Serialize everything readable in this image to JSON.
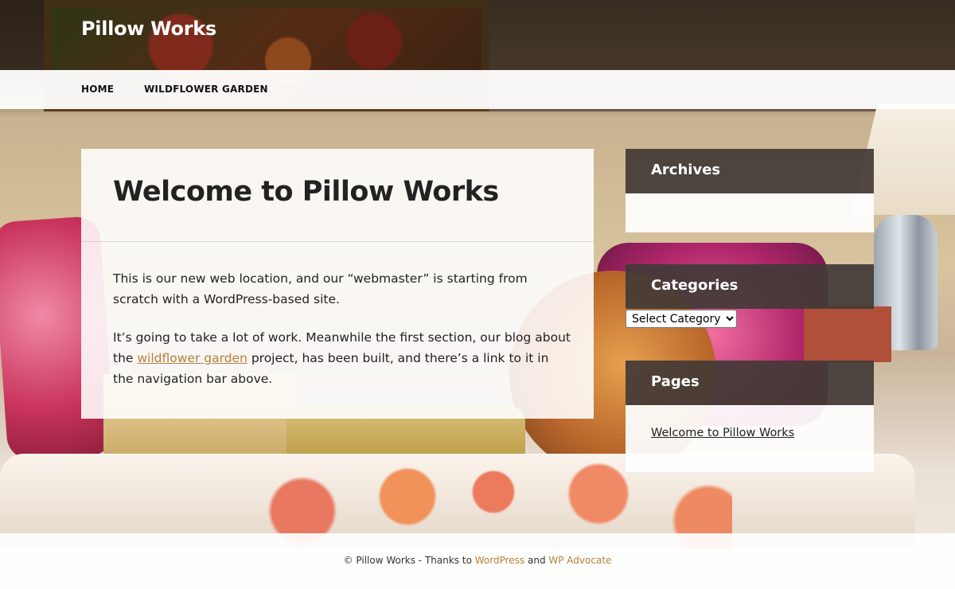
{
  "site": {
    "title": "Pillow Works"
  },
  "nav": {
    "items": [
      {
        "label": "HOME"
      },
      {
        "label": "WILDFLOWER GARDEN"
      }
    ]
  },
  "post": {
    "title": "Welcome to Pillow Works",
    "p1": "This is our new web location, and our “webmaster” is starting from scratch with a WordPress-based site.",
    "p2_before": "It’s going to take a lot of work. Meanwhile the first section, our blog about the ",
    "p2_link": "wildflower garden",
    "p2_after": " project, has been built, and there’s a link to it in the navigation bar above."
  },
  "sidebar": {
    "archives_title": "Archives",
    "categories_title": "Categories",
    "category_select": "Select Category",
    "pages_title": "Pages",
    "pages_items": [
      {
        "label": "Welcome to Pillow Works"
      }
    ]
  },
  "footer": {
    "prefix": "© Pillow Works - Thanks to ",
    "link1": "WordPress",
    "middle": " and ",
    "link2": "WP Advocate"
  },
  "colors": {
    "link_accent": "#b5813a",
    "widget_header": "#423a36"
  }
}
